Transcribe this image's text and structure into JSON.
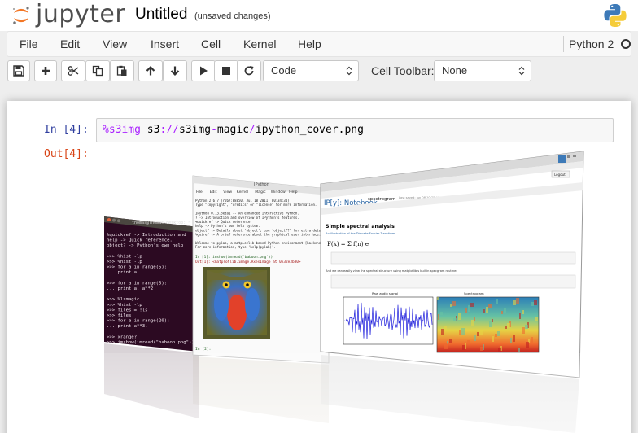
{
  "header": {
    "logo_text": "jupyter",
    "notebook_name": "Untitled",
    "save_status": "(unsaved changes)"
  },
  "menubar": {
    "items": [
      "File",
      "Edit",
      "View",
      "Insert",
      "Cell",
      "Kernel",
      "Help"
    ],
    "kernel_name": "Python 2"
  },
  "toolbar": {
    "buttons": [
      "save-icon",
      "plus-icon",
      "cut-icon",
      "copy-icon",
      "paste-icon",
      "arrow-up-icon",
      "arrow-down-icon",
      "play-icon",
      "stop-icon",
      "restart-icon"
    ],
    "cell_type": "Code",
    "cell_toolbar_label": "Cell Toolbar:",
    "cell_toolbar_value": "None"
  },
  "cell": {
    "in_prompt": "In [4]:",
    "magic": "%s3img",
    "code_mid": " s3",
    "code_sep": "://",
    "code_path_a": "s3img",
    "code_dash": "-",
    "code_path_b": "magic",
    "code_slash": "/",
    "code_file": "ipython_cover.png",
    "out_prompt": "Out[4]:"
  },
  "output": {
    "terminal_title": "thomas@thomas-desktop: ~",
    "terminal_lines": [
      "%quickref -> Introduction and",
      "help      -> Quick reference.",
      "object?   -> Python's own help",
      "",
      ">>> %hist -lp",
      ">>> %hist -lp",
      ">>> for a in range(5):",
      "...     print a",
      "",
      ">>> for a in range(5):",
      "...     print a, a**2",
      "",
      ">>> %lsmagic",
      ">>> %hist -lp",
      ">>> files = !ls",
      ">>> files",
      ">>> for a in range(20):",
      "...     print a**3,",
      "",
      ">>> xrange?",
      ">>> imshow(imread(\"baboon.png\"))"
    ],
    "qt_title": "IPython",
    "qt_menu": [
      "File",
      "Edit",
      "View",
      "Kernel",
      "Magic",
      "Window",
      "Help"
    ],
    "qt_lines": [
      "Python 2.6.7 (r267:88850, Jul 18 2011, 00:34:34)",
      "Type \"copyright\", \"credits\" or \"license\" for more information.",
      "",
      "IPython 0.13.beta1 -- An enhanced Interactive Python.",
      "?         -> Introduction and overview of IPython's features.",
      "%quickref -> Quick reference.",
      "help      -> Python's own help system.",
      "object?   -> Details about 'object', use 'object??' for extra details.",
      "%guiref   -> A brief reference about the graphical user interface.",
      "",
      "Welcome to pylab, a matplotlib-based Python environment [backend: module://IPython.zmq.pylab.backend_inline].",
      "For more information, type 'help(pylab)'."
    ],
    "qt_in1": "In [1]: imshow(imread('baboon.png'))",
    "qt_out1": "Out[1]: <matplotlib.image.AxesImage at 0x32e3b80>",
    "qt_in2": "In [2]:",
    "nb_logo": "IP[y]: Notebook",
    "nb_name": "spectrogram",
    "nb_saved": "Last saved: Jun 08 10:35 AM",
    "nb_logout": "Logout",
    "nb_heading": "Simple spectral analysis",
    "nb_subtext": "An illustration of the Discrete Fourier Transform",
    "nb_text2": "And we can easily view the spectral structure using matplotlib's builtin specgram routine:",
    "plot1_title": "Raw audio signal",
    "plot2_title": "Spectrogram"
  }
}
